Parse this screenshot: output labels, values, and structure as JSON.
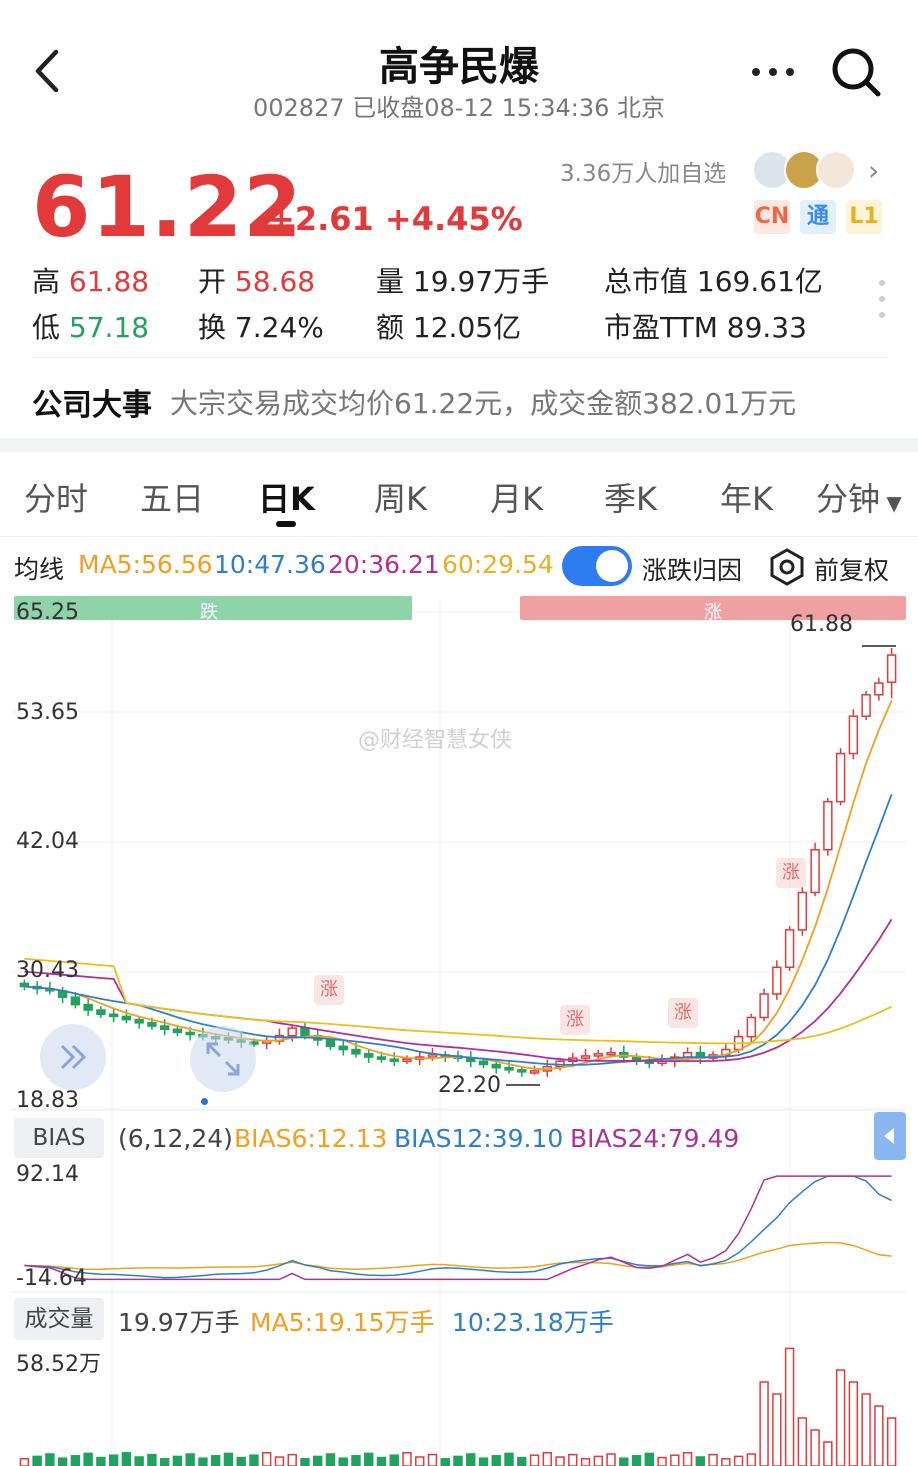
{
  "header": {
    "title": "高争民爆",
    "subtitle": "002827 已收盘08-12 15:34:36 北京"
  },
  "quote": {
    "price": "61.22",
    "change": "+2.61 +4.45%",
    "followers": "3.36万人加自选",
    "tags": [
      "CN",
      "通",
      "L1"
    ],
    "stats": {
      "high_label": "高",
      "high": "61.88",
      "open_label": "开",
      "open": "58.68",
      "volume_label": "量",
      "volume": "19.97万手",
      "mktcap_label": "总市值",
      "mktcap": "169.61亿",
      "low_label": "低",
      "low": "57.18",
      "turnover_label": "换",
      "turnover": "7.24%",
      "amount_label": "额",
      "amount": "12.05亿",
      "pe_label": "市盈TTM",
      "pe": "89.33"
    }
  },
  "event": {
    "label": "公司大事",
    "text": "大宗交易成交均价61.22元，成交金额382.01万元"
  },
  "tabs": [
    "分时",
    "五日",
    "日K",
    "周K",
    "月K",
    "季K",
    "年K",
    "分钟"
  ],
  "active_tab": "日K",
  "ma_row": {
    "label": "均线",
    "ma5": "MA5:56.56",
    "ma10": "10:47.36",
    "ma20": "20:36.21",
    "ma60": "60:29.54",
    "toggle_label": "涨跌归因",
    "fuquan": "前复权"
  },
  "chart": {
    "y_labels": [
      "65.25",
      "53.65",
      "42.04",
      "30.43",
      "18.83"
    ],
    "band_down": "跌",
    "band_up": "涨",
    "high_marker": "61.88",
    "low_marker": "22.20",
    "badge": "涨",
    "watermark": "@财经智慧女侠"
  },
  "bias": {
    "label": "BIAS",
    "params": "(6,12,24)",
    "b6": "BIAS6:12.13",
    "b12": "BIAS12:39.10",
    "b24": "BIAS24:79.49",
    "top": "92.14",
    "bottom": "-14.64"
  },
  "volume": {
    "label": "成交量",
    "value": "19.97万手",
    "ma5": "MA5:19.15万手",
    "ma10": "10:23.18万手",
    "top": "58.52万"
  },
  "colors": {
    "up": "#e23a3a",
    "down": "#1fa35f",
    "ma5": "#f0a020",
    "ma10": "#2f7fc8",
    "ma20": "#b0309a",
    "ma60": "#e8c020",
    "accent": "#2f7bf0"
  },
  "chart_data": {
    "type": "candlestick",
    "y_axis_labels": [
      65.25,
      53.65,
      42.04,
      30.43,
      18.83
    ],
    "period_high": 61.88,
    "period_low": 22.2,
    "closes": [
      30.2,
      30.0,
      29.8,
      29.2,
      28.5,
      28.0,
      27.6,
      27.4,
      27.1,
      26.8,
      26.5,
      26.2,
      25.9,
      25.7,
      25.5,
      25.4,
      25.2,
      25.0,
      24.9,
      25.1,
      25.6,
      26.3,
      25.6,
      25.2,
      24.6,
      24.3,
      23.9,
      23.6,
      23.4,
      23.3,
      23.4,
      23.6,
      23.8,
      23.7,
      23.5,
      23.2,
      22.9,
      22.6,
      22.4,
      22.3,
      22.3,
      22.7,
      23.2,
      23.5,
      23.7,
      23.9,
      24.0,
      23.6,
      23.2,
      23.1,
      23.2,
      23.6,
      24.0,
      23.5,
      23.8,
      24.3,
      25.5,
      27.3,
      29.5,
      32.0,
      35.5,
      39.0,
      43.0,
      47.5,
      52.0,
      55.5,
      57.5,
      58.6,
      61.22
    ],
    "bias": {
      "BIAS6": 12.13,
      "BIAS12": 39.1,
      "BIAS24": 79.49,
      "range": [
        -14.64,
        92.14
      ]
    },
    "volume_top_wan": 58.52
  }
}
